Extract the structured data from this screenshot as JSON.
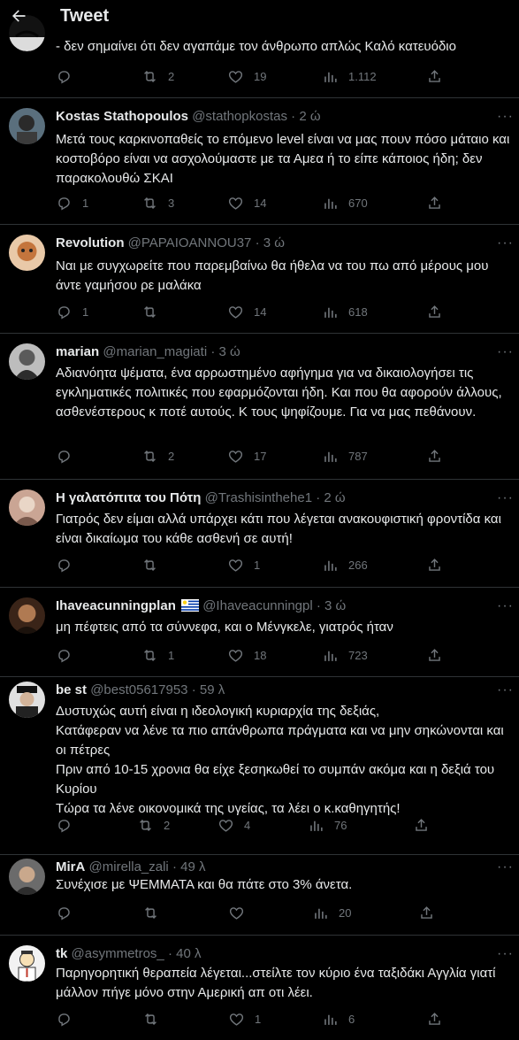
{
  "header": {
    "title": "Tweet"
  },
  "tweets": [
    {
      "name": "",
      "handle": "",
      "time": "",
      "text": "- δεν σημαίνει ότι δεν αγαπάμε τον άνθρωπο απλώς Καλό κατευόδιο",
      "replies": "",
      "retweets": "2",
      "likes": "19",
      "views": "1.112"
    },
    {
      "name": "Kostas Stathopoulos",
      "handle": "@stathopkostas",
      "time": "2 ώ",
      "text": "Μετά τους καρκινοπαθείς το επόμενο level είναι να μας πουν πόσο μάταιο και κοστοβόρο είναι να ασχολούμαστε με τα Αμεα ή το είπε κάποιος ήδη; δεν παρακολουθώ ΣΚΑΙ",
      "replies": "1",
      "retweets": "3",
      "likes": "14",
      "views": "670"
    },
    {
      "name": "Revolution",
      "handle": "@PAPAIOANNOU37",
      "time": "3 ώ",
      "text": "Ναι με συγχωρείτε που παρεμβαίνω θα ήθελα να του πω από μέρους μου άντε γαμήσου ρε μαλάκα",
      "replies": "1",
      "retweets": "",
      "likes": "14",
      "views": "618"
    },
    {
      "name": "marian",
      "handle": "@marian_magiati",
      "time": "3 ώ",
      "text": "Αδιανόητα ψέματα, ένα αρρωστημένο αφήγημα για να δικαιολογήσει τις εγκληματικές πολιτικές που εφαρμόζονται ήδη. Και που θα αφορούν άλλους, ασθενέστερους κ ποτέ αυτούς. Κ τους ψηφίζουμε. Για να μας πεθάνουν.",
      "replies": "",
      "retweets": "2",
      "likes": "17",
      "views": "787"
    },
    {
      "name": "Η γαλατόπιτα του Πότη",
      "handle": "@Trashisinthehe1",
      "time": "2 ώ",
      "text": "Γιατρός δεν είμαι αλλά υπάρχει κάτι που λέγεται ανακουφιστική φροντίδα και είναι δικαίωμα του κάθε ασθενή σε αυτή!",
      "replies": "",
      "retweets": "",
      "likes": "1",
      "views": "266"
    },
    {
      "name": "Ihaveacunningplan",
      "handle": "@Ihaveacunningpl",
      "time": "3 ώ",
      "text": "μη πέφτεις από τα σύννεφα, και ο Μένγκελε, γιατρός ήταν",
      "replies": "",
      "retweets": "1",
      "likes": "18",
      "views": "723"
    },
    {
      "name": "be st",
      "handle": "@best05617953",
      "time": "59 λ",
      "text": "Δυστυχώς αυτή είναι η ιδεολογική κυριαρχία της δεξιάς,\nΚατάφεραν να λένε τα πιο απάνθρωπα πράγματα και να μην σηκώνονται και οι πέτρες\nΠριν από 10-15 χρονια θα είχε ξεσηκωθεί το συμπάν ακόμα και η δεξιά του Κυρίου\nΤώρα τα λένε οικονομικά της υγείας, τα λέει ο κ.καθηγητής!",
      "replies": "",
      "retweets": "2",
      "likes": "4",
      "views": "76"
    },
    {
      "name": "MirA",
      "handle": "@mirella_zali",
      "time": "49 λ",
      "text": "Συνέχισε με ΨΕΜΜΑΤΑ και θα πάτε στο 3% άνετα.",
      "replies": "",
      "retweets": "",
      "likes": "",
      "views": "20"
    },
    {
      "name": "tk",
      "handle": "@asymmetros_",
      "time": "40 λ",
      "text": "Παρηγορητική θεραπεία λέγεται...στείλτε τον κύριο ένα ταξιδάκι Αγγλία γιατί μάλλον πήγε μόνο στην Αμερική απ οτι λέει.",
      "replies": "",
      "retweets": "",
      "likes": "1",
      "views": "6"
    }
  ],
  "separator": "·",
  "more_glyph": "···",
  "colors": {
    "background": "#000000",
    "text": "#e7e9ea",
    "secondary": "#71767b",
    "divider": "#2f3336"
  }
}
